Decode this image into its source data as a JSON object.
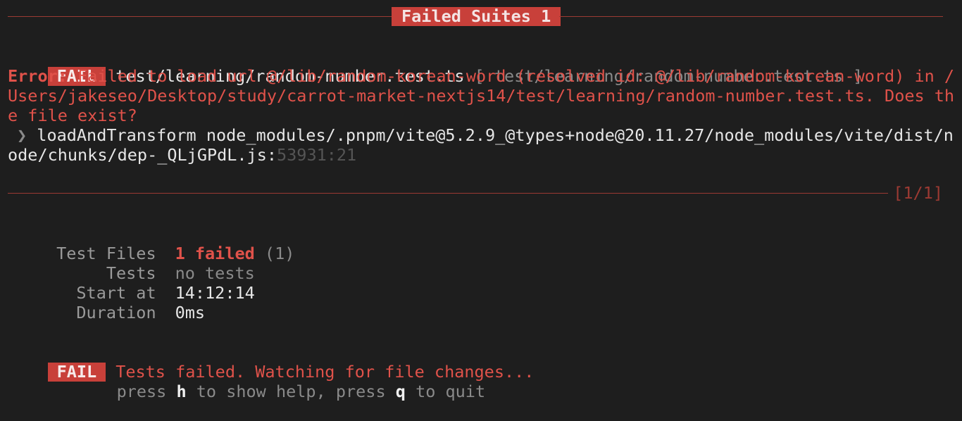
{
  "header": {
    "title": "Failed Suites 1"
  },
  "failure": {
    "badge": "FAIL",
    "file": "test/learning/random-number.test.ts",
    "file_bracket": "[ test/learning/random-number.test.ts ]",
    "error_label": "Error:",
    "error_line1": " Failed to load url @/lib/random-korean-word (resolved id: @/lib/random-korean-word) in /",
    "error_line2": "Users/jakeseo/Desktop/study/carrot-market-nextjs14/test/learning/random-number.test.ts. Does th",
    "error_line3": "e file exist?",
    "stack_marker": "❯",
    "stack_line1": " loadAndTransform node_modules/.pnpm/vite@5.2.9_@types+node@20.11.27/node_modules/vite/dist/n",
    "stack_line2": "ode/chunks/dep-_QLjGPdL.js:",
    "stack_position": "53931:21"
  },
  "pager": "[1/1]",
  "summary": {
    "rows": [
      {
        "label": "Test Files",
        "value": "1 failed",
        "extra": " (1)"
      },
      {
        "label": "Tests",
        "value": "no tests",
        "extra": ""
      },
      {
        "label": "Start at",
        "value": "14:12:14",
        "extra": ""
      },
      {
        "label": "Duration",
        "value": "0ms",
        "extra": ""
      }
    ]
  },
  "footer": {
    "badge": "FAIL",
    "message": "Tests failed. Watching for file changes...",
    "press1": "press ",
    "key_h": "h",
    "show_help": " to show help, press ",
    "key_q": "q",
    "to_quit": " to quit"
  },
  "colors": {
    "background": "#1e1e1e",
    "error_red": "#e0524a",
    "badge_red": "#c8403a",
    "rule_red": "#9c3a33"
  }
}
